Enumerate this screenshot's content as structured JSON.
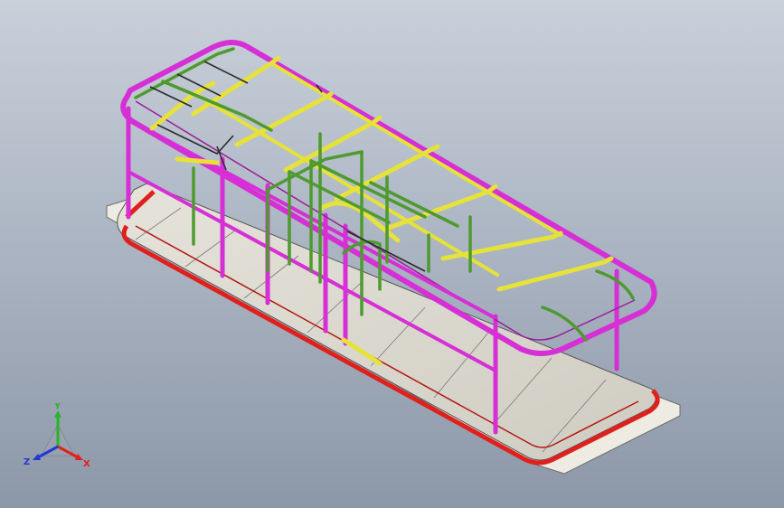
{
  "viewport": {
    "colors": {
      "frame_magenta": "#d62fd6",
      "frame_yellow": "#e6e23a",
      "frame_green": "#4f9a2e",
      "base_red": "#e0201c",
      "floor": "#d9d6cc",
      "plate": "#ebe8e0"
    }
  },
  "triad": {
    "y_label": "Y",
    "z_label": "Z",
    "x_label": "X",
    "colors": {
      "x": "#e0201c",
      "y": "#27b427",
      "z": "#2536d6"
    }
  }
}
